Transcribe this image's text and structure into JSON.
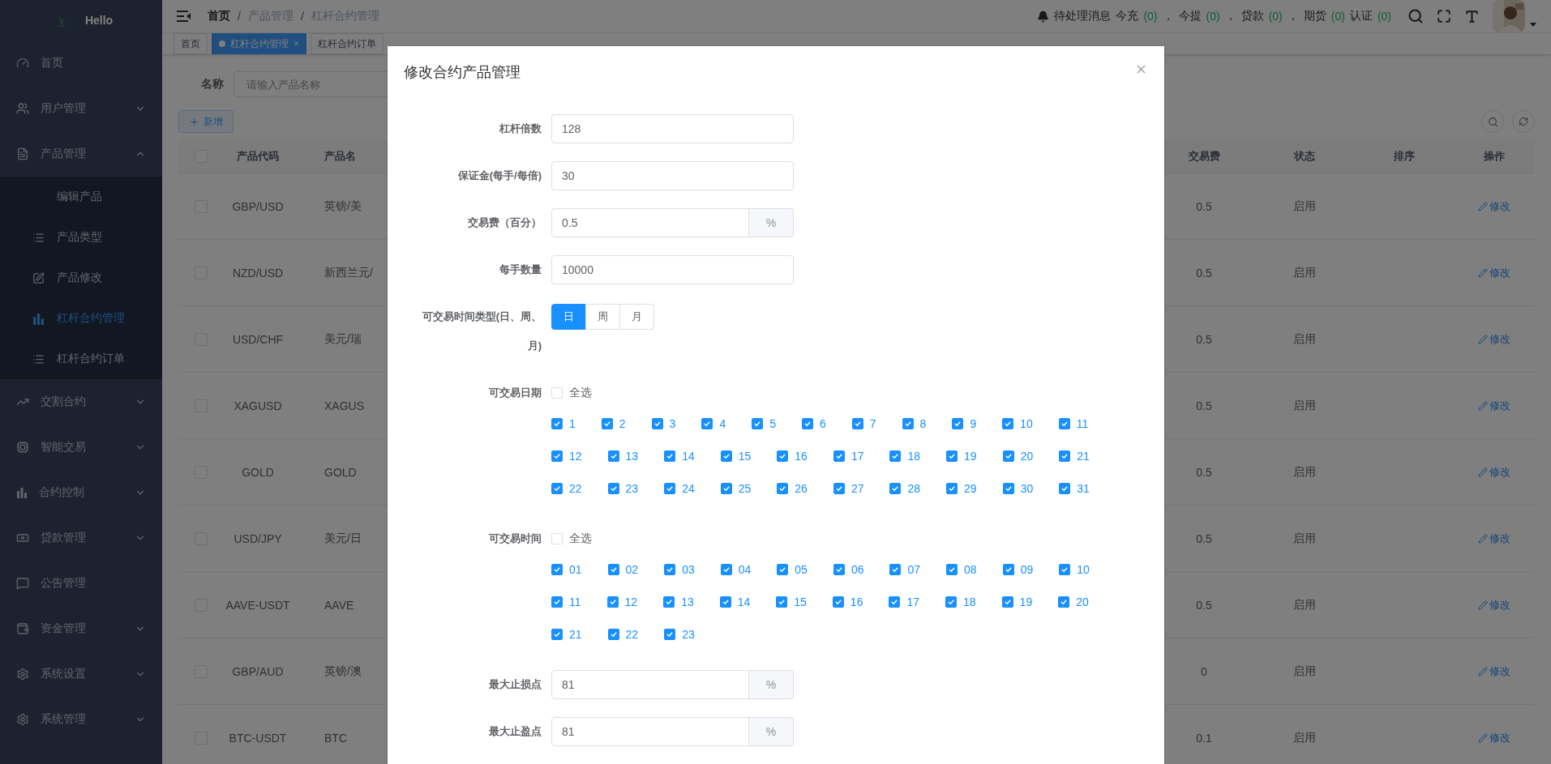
{
  "sidebar": {
    "logo_text": "Hello",
    "items": [
      {
        "label": "首页",
        "kind": "link"
      },
      {
        "label": "用户管理",
        "kind": "submenu",
        "expanded": false
      },
      {
        "label": "产品管理",
        "kind": "submenu",
        "expanded": true,
        "children": [
          {
            "label": "编辑产品",
            "selected": false
          },
          {
            "label": "产品类型",
            "selected": false
          },
          {
            "label": "产品修改",
            "selected": false
          },
          {
            "label": "杠杆合约管理",
            "selected": true
          },
          {
            "label": "杠杆合约订单",
            "selected": false
          }
        ]
      },
      {
        "label": "交割合约",
        "kind": "submenu",
        "expanded": false
      },
      {
        "label": "智能交易",
        "kind": "submenu",
        "expanded": false
      },
      {
        "label": "合约控制",
        "kind": "submenu",
        "expanded": false
      },
      {
        "label": "贷款管理",
        "kind": "submenu",
        "expanded": false
      },
      {
        "label": "公告管理",
        "kind": "link"
      },
      {
        "label": "资金管理",
        "kind": "submenu",
        "expanded": false
      },
      {
        "label": "系统设置",
        "kind": "submenu",
        "expanded": false
      },
      {
        "label": "系统管理",
        "kind": "submenu",
        "expanded": false
      }
    ]
  },
  "header": {
    "breadcrumb": [
      "首页",
      "产品管理",
      "杠杆合约管理"
    ],
    "breadcrumb_separator": "/",
    "notice_label": "待处理消息",
    "notices": [
      {
        "label": "今充",
        "count": "(0)",
        "separator": "，"
      },
      {
        "label": "今提",
        "count": "(0)",
        "separator": "，"
      },
      {
        "label": "贷款",
        "count": "(0)",
        "separator": "，"
      },
      {
        "label": "期货",
        "count": "(0)"
      },
      {
        "label": "认证",
        "count": "(0)"
      }
    ]
  },
  "tags": [
    {
      "label": "首页",
      "selected": false
    },
    {
      "label": "杠杆合约管理",
      "selected": true,
      "close": "×"
    },
    {
      "label": "杠杆合约订单",
      "selected": false
    }
  ],
  "filter": {
    "label": "名称",
    "placeholder": "请输入产品名称"
  },
  "add_button": "新增",
  "table": {
    "header_checked": false,
    "columns_left": [
      "产品代码",
      "产品名"
    ],
    "columns_right": [
      "交易费",
      "状态",
      "排序",
      "操作"
    ],
    "rows": [
      {
        "checked": false,
        "code": "GBP/USD",
        "name": "英镑/美",
        "fee": "0.5",
        "status": "启用",
        "action": "修改"
      },
      {
        "checked": false,
        "code": "NZD/USD",
        "name": "新西兰元/",
        "fee": "0.5",
        "status": "启用",
        "action": "修改"
      },
      {
        "checked": false,
        "code": "USD/CHF",
        "name": "美元/瑞",
        "fee": "0.5",
        "status": "启用",
        "action": "修改"
      },
      {
        "checked": false,
        "code": "XAGUSD",
        "name": "XAGUS",
        "fee": "0.5",
        "status": "启用",
        "action": "修改"
      },
      {
        "checked": false,
        "code": "GOLD",
        "name": "GOLD",
        "fee": "0.5",
        "status": "启用",
        "action": "修改"
      },
      {
        "checked": false,
        "code": "USD/JPY",
        "name": "美元/日",
        "fee": "0.5",
        "status": "启用",
        "action": "修改"
      },
      {
        "checked": false,
        "code": "AAVE-USDT",
        "name": "AAVE",
        "fee": "0.5",
        "status": "启用",
        "action": "修改"
      },
      {
        "checked": false,
        "code": "GBP/AUD",
        "name": "英镑/澳",
        "fee": "0",
        "status": "启用",
        "action": "修改"
      },
      {
        "checked": false,
        "code": "BTC-USDT",
        "name": "BTC",
        "fee": "0.1",
        "status": "启用",
        "action": "修改"
      }
    ]
  },
  "modal": {
    "title": "修改合约产品管理",
    "fields": [
      {
        "kind": "input",
        "label": "杠杆倍数",
        "value": "128"
      },
      {
        "kind": "input",
        "label": "保证金(每手/每倍)",
        "value": "30"
      },
      {
        "kind": "append",
        "label": "交易费（百分）",
        "value": "0.5",
        "unit": "%"
      },
      {
        "kind": "input",
        "label": "每手数量",
        "value": "10000"
      },
      {
        "kind": "radio",
        "label": "可交易时间类型(日、周、月)",
        "options": [
          {
            "label": "日",
            "selected": true
          },
          {
            "label": "周",
            "selected": false
          },
          {
            "label": "月",
            "selected": false
          }
        ]
      },
      {
        "kind": "checks",
        "label": "可交易日期",
        "select_all": {
          "label": "全选",
          "checked": false
        },
        "options": [
          {
            "label": "1",
            "checked": true
          },
          {
            "label": "2",
            "checked": true
          },
          {
            "label": "3",
            "checked": true
          },
          {
            "label": "4",
            "checked": true
          },
          {
            "label": "5",
            "checked": true
          },
          {
            "label": "6",
            "checked": true
          },
          {
            "label": "7",
            "checked": true
          },
          {
            "label": "8",
            "checked": true
          },
          {
            "label": "9",
            "checked": true
          },
          {
            "label": "10",
            "checked": true
          },
          {
            "label": "11",
            "checked": true
          },
          {
            "label": "12",
            "checked": true
          },
          {
            "label": "13",
            "checked": true
          },
          {
            "label": "14",
            "checked": true
          },
          {
            "label": "15",
            "checked": true
          },
          {
            "label": "16",
            "checked": true
          },
          {
            "label": "17",
            "checked": true
          },
          {
            "label": "18",
            "checked": true
          },
          {
            "label": "19",
            "checked": true
          },
          {
            "label": "20",
            "checked": true
          },
          {
            "label": "21",
            "checked": true
          },
          {
            "label": "22",
            "checked": true
          },
          {
            "label": "23",
            "checked": true
          },
          {
            "label": "24",
            "checked": true
          },
          {
            "label": "25",
            "checked": true
          },
          {
            "label": "26",
            "checked": true
          },
          {
            "label": "27",
            "checked": true
          },
          {
            "label": "28",
            "checked": true
          },
          {
            "label": "29",
            "checked": true
          },
          {
            "label": "30",
            "checked": true
          },
          {
            "label": "31",
            "checked": true
          }
        ]
      },
      {
        "kind": "checks",
        "label": "可交易时间",
        "select_all": {
          "label": "全选",
          "checked": false
        },
        "options": [
          {
            "label": "01",
            "checked": true
          },
          {
            "label": "02",
            "checked": true
          },
          {
            "label": "03",
            "checked": true
          },
          {
            "label": "04",
            "checked": true
          },
          {
            "label": "05",
            "checked": true
          },
          {
            "label": "06",
            "checked": true
          },
          {
            "label": "07",
            "checked": true
          },
          {
            "label": "08",
            "checked": true
          },
          {
            "label": "09",
            "checked": true
          },
          {
            "label": "10",
            "checked": true
          },
          {
            "label": "11",
            "checked": true
          },
          {
            "label": "12",
            "checked": true
          },
          {
            "label": "13",
            "checked": true
          },
          {
            "label": "14",
            "checked": true
          },
          {
            "label": "15",
            "checked": true
          },
          {
            "label": "16",
            "checked": true
          },
          {
            "label": "17",
            "checked": true
          },
          {
            "label": "18",
            "checked": true
          },
          {
            "label": "19",
            "checked": true
          },
          {
            "label": "20",
            "checked": true
          },
          {
            "label": "21",
            "checked": true
          },
          {
            "label": "22",
            "checked": true
          },
          {
            "label": "23",
            "checked": true
          }
        ]
      },
      {
        "kind": "append",
        "label": "最大止损点",
        "value": "81",
        "unit": "%"
      },
      {
        "kind": "append",
        "label": "最大止盈点",
        "value": "81",
        "unit": "%"
      }
    ]
  }
}
